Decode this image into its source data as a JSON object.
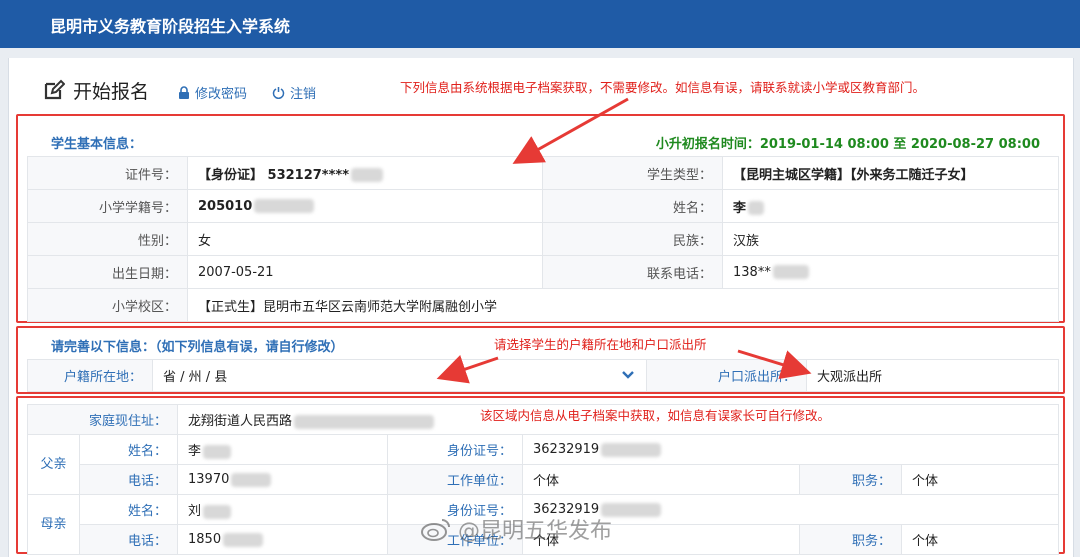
{
  "app": {
    "title": "昆明市义务教育阶段招生入学系统"
  },
  "page": {
    "title": "开始报名",
    "change_password": "修改密码",
    "logout": "注销"
  },
  "notes": {
    "top": "下列信息由系统根据电子档案获取，不需要修改。如信息有误，请联系就读小学或区教育部门。",
    "address": "请选择学生的户籍所在地和户口派出所",
    "family": "该区域内信息从电子档案中获取，如信息有误家长可自行修改。"
  },
  "basic": {
    "header": "学生基本信息：",
    "apply_time": "小升初报名时间：2019-01-14 08:00 至 2020-08-27 08:00",
    "id_label": "证件号：",
    "id_value": "【身份证】 532127****",
    "type_label": "学生类型：",
    "type_value": "【昆明主城区学籍】【外来务工随迁子女】",
    "school_no_label": "小学学籍号：",
    "school_no_value": "205010",
    "name_label": "姓名：",
    "name_value": "李",
    "gender_label": "性别：",
    "gender_value": "女",
    "ethnic_label": "民族：",
    "ethnic_value": "汉族",
    "birth_label": "出生日期：",
    "birth_value": "2007-05-21",
    "phone_label": "联系电话：",
    "phone_value": "138**",
    "campus_label": "小学校区：",
    "campus_value": "【正式生】昆明市五华区云南师范大学附属融创小学"
  },
  "complete": {
    "header": "请完善以下信息：（如下列信息有误，请自行修改）",
    "huji_label": "户籍所在地：",
    "huji_placeholder": "省 / 州 / 县",
    "police_label": "户口派出所：",
    "police_value": "大观派出所"
  },
  "family": {
    "addr_label": "家庭现住址：",
    "addr_value": "龙翔街道人民西路",
    "father": {
      "rel": "父亲",
      "name_label": "姓名：",
      "name_value": "李",
      "id_label": "身份证号：",
      "id_value": "36232919",
      "phone_label": "电话：",
      "phone_value": "13970",
      "work_label": "工作单位：",
      "work_value": "个体",
      "post_label": "职务：",
      "post_value": "个体"
    },
    "mother": {
      "rel": "母亲",
      "name_label": "姓名：",
      "name_value": "刘",
      "id_label": "身份证号：",
      "id_value": "36232919",
      "phone_label": "电话：",
      "phone_value": "1850",
      "work_label": "工作单位：",
      "work_value": "个体",
      "post_label": "职务：",
      "post_value": "个体"
    }
  },
  "watermark": "@昆明五华发布",
  "colors": {
    "topbar": "#1f5ba6",
    "accent": "#2f6fb6",
    "annotation": "#e63a35",
    "time": "#1f8a1f"
  }
}
